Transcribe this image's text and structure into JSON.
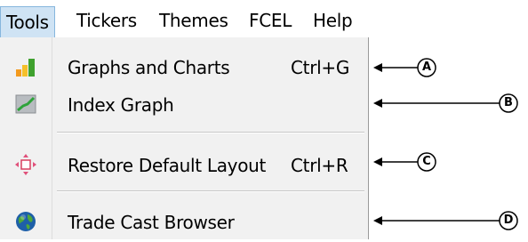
{
  "menubar": {
    "items": [
      {
        "label": "Tools"
      },
      {
        "label": "Tickers"
      },
      {
        "label": "Themes"
      },
      {
        "label": "FCEL"
      },
      {
        "label": "Help"
      }
    ]
  },
  "tools_menu": {
    "items": [
      {
        "label": "Graphs and Charts",
        "shortcut": "Ctrl+G",
        "icon": "bar-chart-icon"
      },
      {
        "label": "Index Graph",
        "shortcut": "",
        "icon": "line-graph-icon"
      },
      {
        "label": "Restore Default Layout",
        "shortcut": "Ctrl+R",
        "icon": "layout-icon"
      },
      {
        "label": "Trade Cast Browser",
        "shortcut": "",
        "icon": "globe-icon"
      }
    ]
  },
  "callouts": [
    "A",
    "B",
    "C",
    "D"
  ],
  "colors": {
    "menu_highlight": "#cfe3f4",
    "menu_background": "#f1f1f1",
    "globe_blue": "#1e5fa8",
    "chart_orange": "#f39a1e",
    "chart_green": "#3fa12e"
  }
}
